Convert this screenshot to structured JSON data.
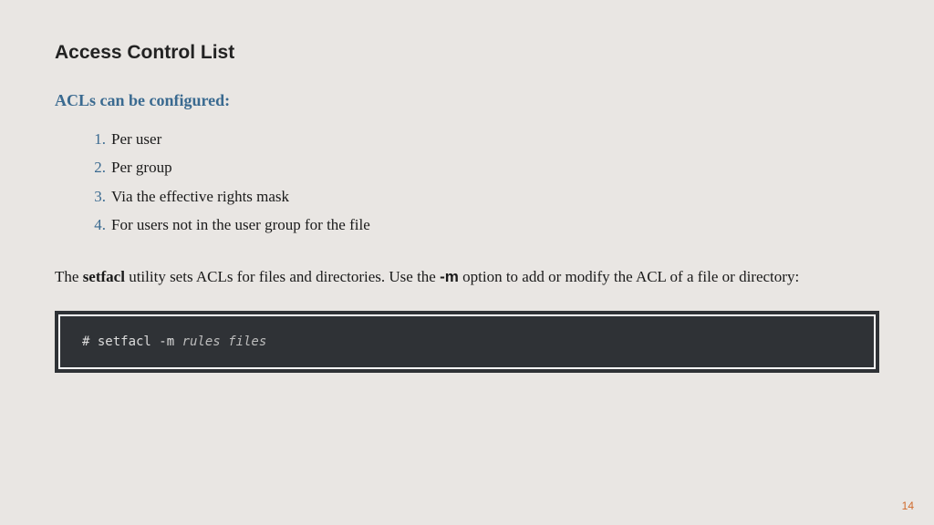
{
  "title": "Access Control List",
  "subheading": "ACLs can be configured:",
  "list": {
    "items": [
      {
        "num": "1.",
        "text": "Per user"
      },
      {
        "num": "2.",
        "text": "Per group"
      },
      {
        "num": "3.",
        "text": "Via the effective rights mask"
      },
      {
        "num": "4.",
        "text": "For users not in the user group for the file"
      }
    ]
  },
  "desc": {
    "pre": "The ",
    "bold1": "setfacl",
    "mid": " utility sets ACLs for files and directories. Use the ",
    "bold2": "-m",
    "post": " option to add or modify the ACL of a file or directory:"
  },
  "code": {
    "prompt": "# ",
    "cmd": "setfacl -m ",
    "args": "rules files"
  },
  "page_number": "14"
}
